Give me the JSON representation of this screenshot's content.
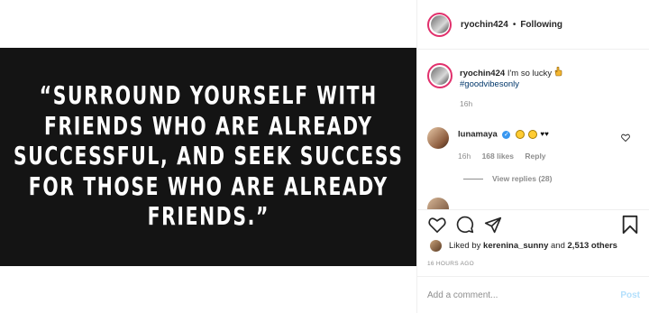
{
  "post": {
    "quote_lines": [
      "“SURROUND YOURSELF WITH",
      "FRIENDS WHO ARE ALREADY",
      "SUCCESSFUL, AND SEEK SUCCESS",
      "FOR THOSE WHO ARE ALREADY",
      "FRIENDS.”"
    ]
  },
  "header": {
    "username": "ryochin424",
    "separator": "•",
    "follow_status": "Following"
  },
  "caption": {
    "username": "ryochin424",
    "text": "I'm so lucky",
    "emoji_icon": "hand-icon",
    "hashtag": "#goodvibesonly",
    "time": "16h"
  },
  "comment": {
    "username": "lunamaya",
    "verified_icon": "verified-badge-icon",
    "hearts": "♥♥",
    "time": "16h",
    "likes": "168 likes",
    "reply": "Reply"
  },
  "view_replies": "View replies (28)",
  "likes": {
    "prefix": "Liked by",
    "user": "kerenina_sunny",
    "joiner": "and",
    "others": "2,513 others"
  },
  "time_ago": "16 HOURS AGO",
  "add_comment": {
    "placeholder": "Add a comment...",
    "post_label": "Post"
  },
  "colors": {
    "link": "#00376b",
    "post_disabled": "#b2dffc",
    "verified": "#3897f0"
  }
}
